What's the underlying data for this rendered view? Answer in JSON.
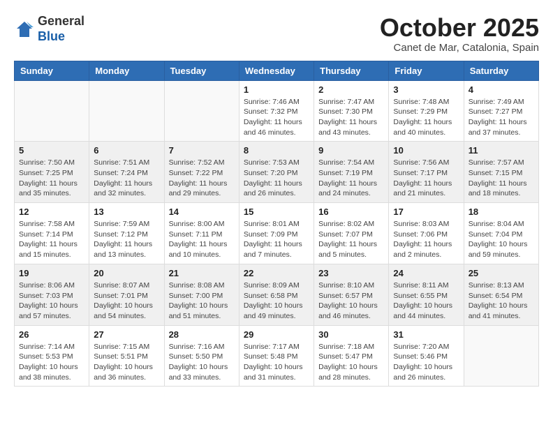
{
  "header": {
    "logo_general": "General",
    "logo_blue": "Blue",
    "month_title": "October 2025",
    "location": "Canet de Mar, Catalonia, Spain"
  },
  "weekdays": [
    "Sunday",
    "Monday",
    "Tuesday",
    "Wednesday",
    "Thursday",
    "Friday",
    "Saturday"
  ],
  "weeks": [
    [
      {
        "day": "",
        "text": ""
      },
      {
        "day": "",
        "text": ""
      },
      {
        "day": "",
        "text": ""
      },
      {
        "day": "1",
        "text": "Sunrise: 7:46 AM\nSunset: 7:32 PM\nDaylight: 11 hours and 46 minutes."
      },
      {
        "day": "2",
        "text": "Sunrise: 7:47 AM\nSunset: 7:30 PM\nDaylight: 11 hours and 43 minutes."
      },
      {
        "day": "3",
        "text": "Sunrise: 7:48 AM\nSunset: 7:29 PM\nDaylight: 11 hours and 40 minutes."
      },
      {
        "day": "4",
        "text": "Sunrise: 7:49 AM\nSunset: 7:27 PM\nDaylight: 11 hours and 37 minutes."
      }
    ],
    [
      {
        "day": "5",
        "text": "Sunrise: 7:50 AM\nSunset: 7:25 PM\nDaylight: 11 hours and 35 minutes."
      },
      {
        "day": "6",
        "text": "Sunrise: 7:51 AM\nSunset: 7:24 PM\nDaylight: 11 hours and 32 minutes."
      },
      {
        "day": "7",
        "text": "Sunrise: 7:52 AM\nSunset: 7:22 PM\nDaylight: 11 hours and 29 minutes."
      },
      {
        "day": "8",
        "text": "Sunrise: 7:53 AM\nSunset: 7:20 PM\nDaylight: 11 hours and 26 minutes."
      },
      {
        "day": "9",
        "text": "Sunrise: 7:54 AM\nSunset: 7:19 PM\nDaylight: 11 hours and 24 minutes."
      },
      {
        "day": "10",
        "text": "Sunrise: 7:56 AM\nSunset: 7:17 PM\nDaylight: 11 hours and 21 minutes."
      },
      {
        "day": "11",
        "text": "Sunrise: 7:57 AM\nSunset: 7:15 PM\nDaylight: 11 hours and 18 minutes."
      }
    ],
    [
      {
        "day": "12",
        "text": "Sunrise: 7:58 AM\nSunset: 7:14 PM\nDaylight: 11 hours and 15 minutes."
      },
      {
        "day": "13",
        "text": "Sunrise: 7:59 AM\nSunset: 7:12 PM\nDaylight: 11 hours and 13 minutes."
      },
      {
        "day": "14",
        "text": "Sunrise: 8:00 AM\nSunset: 7:11 PM\nDaylight: 11 hours and 10 minutes."
      },
      {
        "day": "15",
        "text": "Sunrise: 8:01 AM\nSunset: 7:09 PM\nDaylight: 11 hours and 7 minutes."
      },
      {
        "day": "16",
        "text": "Sunrise: 8:02 AM\nSunset: 7:07 PM\nDaylight: 11 hours and 5 minutes."
      },
      {
        "day": "17",
        "text": "Sunrise: 8:03 AM\nSunset: 7:06 PM\nDaylight: 11 hours and 2 minutes."
      },
      {
        "day": "18",
        "text": "Sunrise: 8:04 AM\nSunset: 7:04 PM\nDaylight: 10 hours and 59 minutes."
      }
    ],
    [
      {
        "day": "19",
        "text": "Sunrise: 8:06 AM\nSunset: 7:03 PM\nDaylight: 10 hours and 57 minutes."
      },
      {
        "day": "20",
        "text": "Sunrise: 8:07 AM\nSunset: 7:01 PM\nDaylight: 10 hours and 54 minutes."
      },
      {
        "day": "21",
        "text": "Sunrise: 8:08 AM\nSunset: 7:00 PM\nDaylight: 10 hours and 51 minutes."
      },
      {
        "day": "22",
        "text": "Sunrise: 8:09 AM\nSunset: 6:58 PM\nDaylight: 10 hours and 49 minutes."
      },
      {
        "day": "23",
        "text": "Sunrise: 8:10 AM\nSunset: 6:57 PM\nDaylight: 10 hours and 46 minutes."
      },
      {
        "day": "24",
        "text": "Sunrise: 8:11 AM\nSunset: 6:55 PM\nDaylight: 10 hours and 44 minutes."
      },
      {
        "day": "25",
        "text": "Sunrise: 8:13 AM\nSunset: 6:54 PM\nDaylight: 10 hours and 41 minutes."
      }
    ],
    [
      {
        "day": "26",
        "text": "Sunrise: 7:14 AM\nSunset: 5:53 PM\nDaylight: 10 hours and 38 minutes."
      },
      {
        "day": "27",
        "text": "Sunrise: 7:15 AM\nSunset: 5:51 PM\nDaylight: 10 hours and 36 minutes."
      },
      {
        "day": "28",
        "text": "Sunrise: 7:16 AM\nSunset: 5:50 PM\nDaylight: 10 hours and 33 minutes."
      },
      {
        "day": "29",
        "text": "Sunrise: 7:17 AM\nSunset: 5:48 PM\nDaylight: 10 hours and 31 minutes."
      },
      {
        "day": "30",
        "text": "Sunrise: 7:18 AM\nSunset: 5:47 PM\nDaylight: 10 hours and 28 minutes."
      },
      {
        "day": "31",
        "text": "Sunrise: 7:20 AM\nSunset: 5:46 PM\nDaylight: 10 hours and 26 minutes."
      },
      {
        "day": "",
        "text": ""
      }
    ]
  ]
}
